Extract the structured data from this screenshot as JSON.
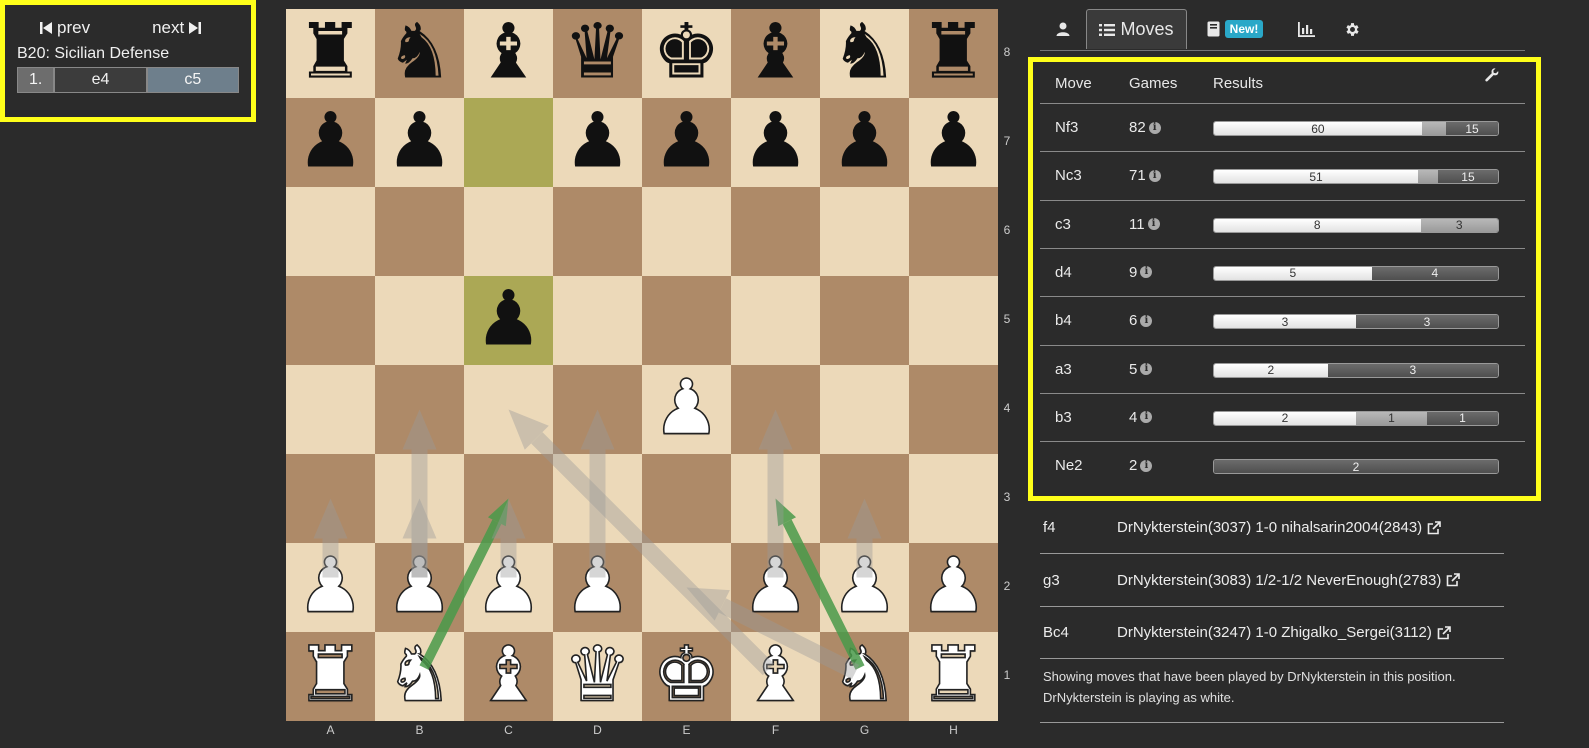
{
  "nav": {
    "prev_label": "prev",
    "next_label": "next",
    "opening": "B20: Sicilian Defense",
    "moves": [
      {
        "num": "1.",
        "white": "e4",
        "black": "c5"
      }
    ]
  },
  "board": {
    "ranks": [
      "8",
      "7",
      "6",
      "5",
      "4",
      "3",
      "2",
      "1"
    ],
    "files": [
      "A",
      "B",
      "C",
      "D",
      "E",
      "F",
      "G",
      "H"
    ],
    "light_color": "#ecd9b9",
    "dark_color": "#ae8a68",
    "highlight_color": "#aba855",
    "highlighted_squares": [
      "c7",
      "c5"
    ],
    "pieces": [
      {
        "sq": "a8",
        "glyph": "♜",
        "color": "b",
        "name": "black-rook"
      },
      {
        "sq": "b8",
        "glyph": "♞",
        "color": "b",
        "name": "black-knight"
      },
      {
        "sq": "c8",
        "glyph": "♝",
        "color": "b",
        "name": "black-bishop"
      },
      {
        "sq": "d8",
        "glyph": "♛",
        "color": "b",
        "name": "black-queen"
      },
      {
        "sq": "e8",
        "glyph": "♚",
        "color": "b",
        "name": "black-king"
      },
      {
        "sq": "f8",
        "glyph": "♝",
        "color": "b",
        "name": "black-bishop"
      },
      {
        "sq": "g8",
        "glyph": "♞",
        "color": "b",
        "name": "black-knight"
      },
      {
        "sq": "h8",
        "glyph": "♜",
        "color": "b",
        "name": "black-rook"
      },
      {
        "sq": "a7",
        "glyph": "♟",
        "color": "b",
        "name": "black-pawn"
      },
      {
        "sq": "b7",
        "glyph": "♟",
        "color": "b",
        "name": "black-pawn"
      },
      {
        "sq": "d7",
        "glyph": "♟",
        "color": "b",
        "name": "black-pawn"
      },
      {
        "sq": "e7",
        "glyph": "♟",
        "color": "b",
        "name": "black-pawn"
      },
      {
        "sq": "f7",
        "glyph": "♟",
        "color": "b",
        "name": "black-pawn"
      },
      {
        "sq": "g7",
        "glyph": "♟",
        "color": "b",
        "name": "black-pawn"
      },
      {
        "sq": "h7",
        "glyph": "♟",
        "color": "b",
        "name": "black-pawn"
      },
      {
        "sq": "c5",
        "glyph": "♟",
        "color": "b",
        "name": "black-pawn"
      },
      {
        "sq": "e4",
        "glyph": "♟",
        "color": "w",
        "name": "white-pawn"
      },
      {
        "sq": "a2",
        "glyph": "♟",
        "color": "w",
        "name": "white-pawn"
      },
      {
        "sq": "b2",
        "glyph": "♟",
        "color": "w",
        "name": "white-pawn"
      },
      {
        "sq": "c2",
        "glyph": "♟",
        "color": "w",
        "name": "white-pawn"
      },
      {
        "sq": "d2",
        "glyph": "♟",
        "color": "w",
        "name": "white-pawn"
      },
      {
        "sq": "f2",
        "glyph": "♟",
        "color": "w",
        "name": "white-pawn"
      },
      {
        "sq": "g2",
        "glyph": "♟",
        "color": "w",
        "name": "white-pawn"
      },
      {
        "sq": "h2",
        "glyph": "♟",
        "color": "w",
        "name": "white-pawn"
      },
      {
        "sq": "a1",
        "glyph": "♜",
        "color": "w",
        "name": "white-rook"
      },
      {
        "sq": "b1",
        "glyph": "♞",
        "color": "w",
        "name": "white-knight"
      },
      {
        "sq": "c1",
        "glyph": "♝",
        "color": "w",
        "name": "white-bishop"
      },
      {
        "sq": "d1",
        "glyph": "♛",
        "color": "w",
        "name": "white-queen"
      },
      {
        "sq": "e1",
        "glyph": "♚",
        "color": "w",
        "name": "white-king"
      },
      {
        "sq": "f1",
        "glyph": "♝",
        "color": "w",
        "name": "white-bishop"
      },
      {
        "sq": "g1",
        "glyph": "♞",
        "color": "w",
        "name": "white-knight"
      },
      {
        "sq": "h1",
        "glyph": "♜",
        "color": "w",
        "name": "white-rook"
      }
    ],
    "arrows": [
      {
        "from": "b1",
        "to": "c3",
        "kind": "green"
      },
      {
        "from": "g1",
        "to": "f3",
        "kind": "green"
      },
      {
        "from": "g1",
        "to": "e2",
        "kind": "grey"
      },
      {
        "from": "a2",
        "to": "a3",
        "kind": "grey"
      },
      {
        "from": "b2",
        "to": "b3",
        "kind": "grey"
      },
      {
        "from": "b2",
        "to": "b4",
        "kind": "grey"
      },
      {
        "from": "c2",
        "to": "c3",
        "kind": "grey"
      },
      {
        "from": "d2",
        "to": "d4",
        "kind": "grey"
      },
      {
        "from": "f2",
        "to": "f4",
        "kind": "grey"
      },
      {
        "from": "g2",
        "to": "g3",
        "kind": "grey"
      },
      {
        "from": "f1",
        "to": "c4",
        "kind": "grey"
      }
    ],
    "arrow_colors": {
      "green": "#4a9a4a",
      "grey": "#9a9a9a"
    }
  },
  "tabs": {
    "profile_icon": "user-icon",
    "moves_label": "Moves",
    "book_icon": "book-icon",
    "new_badge": "New!",
    "stats_icon": "bar-chart-icon",
    "settings_icon": "gear-icon"
  },
  "moves_table": {
    "headers": {
      "move": "Move",
      "games": "Games",
      "results": "Results"
    },
    "rows": [
      {
        "move": "Nf3",
        "games": "82",
        "white": 60,
        "draw": 7,
        "black": 15,
        "wl": "60",
        "dl": "",
        "bl": "15"
      },
      {
        "move": "Nc3",
        "games": "71",
        "white": 51,
        "draw": 5,
        "black": 15,
        "wl": "51",
        "dl": "",
        "bl": "15"
      },
      {
        "move": "c3",
        "games": "11",
        "white": 8,
        "draw": 3,
        "black": 0,
        "wl": "8",
        "dl": "3",
        "bl": ""
      },
      {
        "move": "d4",
        "games": "9",
        "white": 5,
        "draw": 0,
        "black": 4,
        "wl": "5",
        "dl": "",
        "bl": "4"
      },
      {
        "move": "b4",
        "games": "6",
        "white": 3,
        "draw": 0,
        "black": 3,
        "wl": "3",
        "dl": "",
        "bl": "3"
      },
      {
        "move": "a3",
        "games": "5",
        "white": 2,
        "draw": 0,
        "black": 3,
        "wl": "2",
        "dl": "",
        "bl": "3"
      },
      {
        "move": "b3",
        "games": "4",
        "white": 2,
        "draw": 1,
        "black": 1,
        "wl": "2",
        "dl": "1",
        "bl": "1"
      },
      {
        "move": "Ne2",
        "games": "2",
        "white": 0,
        "draw": 0,
        "black": 2,
        "wl": "",
        "dl": "",
        "bl": "2"
      }
    ]
  },
  "single_games": [
    {
      "move": "f4",
      "game": "DrNykterstein(3037) 1-0 nihalsarin2004(2843)"
    },
    {
      "move": "g3",
      "game": "DrNykterstein(3083) 1/2-1/2 NeverEnough(2783)"
    },
    {
      "move": "Bc4",
      "game": "DrNykterstein(3247) 1-0 Zhigalko_Sergei(3112)"
    }
  ],
  "note": {
    "line1": "Showing moves that have been played by DrNykterstein in this position.",
    "line2": "DrNykterstein is playing as white."
  },
  "accent": "#ffff1a"
}
